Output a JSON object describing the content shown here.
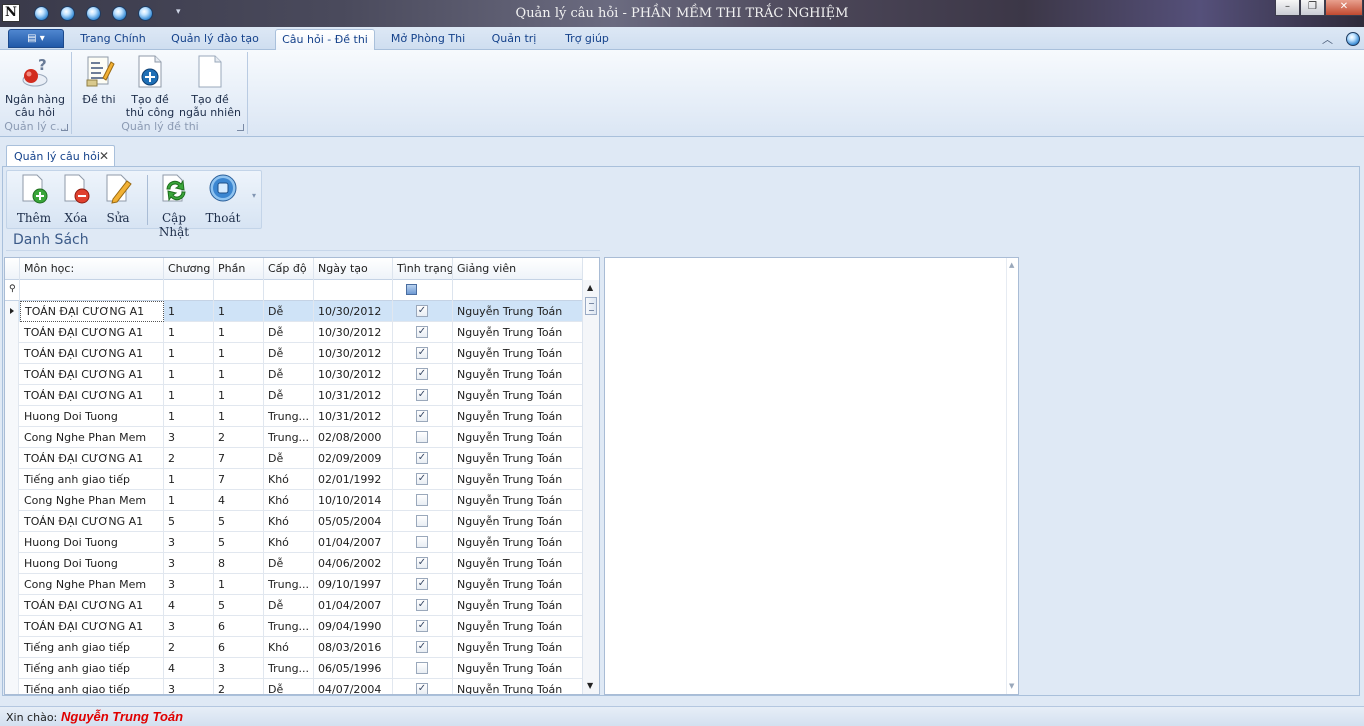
{
  "window": {
    "title": "Quản lý câu hỏi - PHẦN MỀM THI TRẮC NGHIỆM",
    "app_icon_letter": "N",
    "controls": [
      "minimize",
      "restore",
      "close"
    ]
  },
  "ribbon": {
    "tabs": [
      {
        "label": "Trang Chính",
        "active": false
      },
      {
        "label": "Quản lý đào tạo",
        "active": false
      },
      {
        "label": "Câu hỏi - Đề thi",
        "active": true
      },
      {
        "label": "Mở Phòng Thi",
        "active": false
      },
      {
        "label": "Quản trị",
        "active": false
      },
      {
        "label": "Trợ giúp",
        "active": false
      }
    ],
    "groups": [
      {
        "label": "Quản lý c...",
        "buttons": [
          {
            "label_line1": "Ngân hàng",
            "label_line2": "câu hỏi",
            "icon": "question-bank-icon"
          }
        ]
      },
      {
        "label": "Quản lý đề thi",
        "buttons": [
          {
            "label_line1": "Đề thi",
            "label_line2": "",
            "icon": "exam-icon"
          },
          {
            "label_line1": "Tạo đề",
            "label_line2": "thủ công",
            "icon": "manual-exam-icon"
          },
          {
            "label_line1": "Tạo đề",
            "label_line2": "ngẫu nhiên",
            "icon": "random-exam-icon"
          }
        ]
      }
    ]
  },
  "document_tab": {
    "label": "Quản lý câu hỏi",
    "close_glyph": "✕"
  },
  "toolbar": {
    "buttons": [
      {
        "label": "Thêm",
        "icon": "add-doc-icon"
      },
      {
        "label": "Xóa",
        "icon": "delete-doc-icon"
      },
      {
        "label": "Sửa",
        "icon": "edit-doc-icon"
      },
      {
        "label": "Cập Nhật",
        "icon": "refresh-icon"
      },
      {
        "label": "Thoát",
        "icon": "exit-icon"
      }
    ]
  },
  "section_title": "Danh Sách",
  "grid": {
    "columns": [
      "Môn học:",
      "Chương",
      "Phần",
      "Cấp độ",
      "Ngày tạo",
      "Tình trạng",
      "Giảng viên"
    ],
    "rows": [
      {
        "mon": "TOÁN ĐẠI CƯƠNG A1",
        "chuong": "1",
        "phan": "1",
        "capdo": "Dễ",
        "ngay": "10/30/2012",
        "checked": true,
        "gv": "Nguyễn Trung Toán"
      },
      {
        "mon": "TOÁN ĐẠI CƯƠNG A1",
        "chuong": "1",
        "phan": "1",
        "capdo": "Dễ",
        "ngay": "10/30/2012",
        "checked": true,
        "gv": "Nguyễn Trung Toán"
      },
      {
        "mon": "TOÁN ĐẠI CƯƠNG A1",
        "chuong": "1",
        "phan": "1",
        "capdo": "Dễ",
        "ngay": "10/30/2012",
        "checked": true,
        "gv": "Nguyễn Trung Toán"
      },
      {
        "mon": "TOÁN ĐẠI CƯƠNG A1",
        "chuong": "1",
        "phan": "1",
        "capdo": "Dễ",
        "ngay": "10/30/2012",
        "checked": true,
        "gv": "Nguyễn Trung Toán"
      },
      {
        "mon": "TOÁN ĐẠI CƯƠNG A1",
        "chuong": "1",
        "phan": "1",
        "capdo": "Dễ",
        "ngay": "10/31/2012",
        "checked": true,
        "gv": "Nguyễn Trung Toán"
      },
      {
        "mon": "Huong Doi Tuong",
        "chuong": "1",
        "phan": "1",
        "capdo": "Trung...",
        "ngay": "10/31/2012",
        "checked": true,
        "gv": "Nguyễn Trung Toán"
      },
      {
        "mon": "Cong Nghe Phan Mem",
        "chuong": "3",
        "phan": "2",
        "capdo": "Trung...",
        "ngay": "02/08/2000",
        "checked": false,
        "gv": "Nguyễn Trung Toán"
      },
      {
        "mon": "TOÁN ĐẠI CƯƠNG A1",
        "chuong": "2",
        "phan": "7",
        "capdo": "Dễ",
        "ngay": "02/09/2009",
        "checked": true,
        "gv": "Nguyễn Trung Toán"
      },
      {
        "mon": "Tiếng anh giao tiếp",
        "chuong": "1",
        "phan": "7",
        "capdo": "Khó",
        "ngay": "02/01/1992",
        "checked": true,
        "gv": "Nguyễn Trung Toán"
      },
      {
        "mon": "Cong Nghe Phan Mem",
        "chuong": "1",
        "phan": "4",
        "capdo": "Khó",
        "ngay": "10/10/2014",
        "checked": false,
        "gv": "Nguyễn Trung Toán"
      },
      {
        "mon": "TOÁN ĐẠI CƯƠNG A1",
        "chuong": "5",
        "phan": "5",
        "capdo": "Khó",
        "ngay": "05/05/2004",
        "checked": false,
        "gv": "Nguyễn Trung Toán"
      },
      {
        "mon": "Huong Doi Tuong",
        "chuong": "3",
        "phan": "5",
        "capdo": "Khó",
        "ngay": "01/04/2007",
        "checked": false,
        "gv": "Nguyễn Trung Toán"
      },
      {
        "mon": "Huong Doi Tuong",
        "chuong": "3",
        "phan": "8",
        "capdo": "Dễ",
        "ngay": "04/06/2002",
        "checked": true,
        "gv": "Nguyễn Trung Toán"
      },
      {
        "mon": "Cong Nghe Phan Mem",
        "chuong": "3",
        "phan": "1",
        "capdo": "Trung...",
        "ngay": "09/10/1997",
        "checked": true,
        "gv": "Nguyễn Trung Toán"
      },
      {
        "mon": "TOÁN ĐẠI CƯƠNG A1",
        "chuong": "4",
        "phan": "5",
        "capdo": "Dễ",
        "ngay": "01/04/2007",
        "checked": true,
        "gv": "Nguyễn Trung Toán"
      },
      {
        "mon": "TOÁN ĐẠI CƯƠNG A1",
        "chuong": "3",
        "phan": "6",
        "capdo": "Trung...",
        "ngay": "09/04/1990",
        "checked": true,
        "gv": "Nguyễn Trung Toán"
      },
      {
        "mon": "Tiếng anh giao tiếp",
        "chuong": "2",
        "phan": "6",
        "capdo": "Khó",
        "ngay": "08/03/2016",
        "checked": true,
        "gv": "Nguyễn Trung Toán"
      },
      {
        "mon": "Tiếng anh giao tiếp",
        "chuong": "4",
        "phan": "3",
        "capdo": "Trung...",
        "ngay": "06/05/1996",
        "checked": false,
        "gv": "Nguyễn Trung Toán"
      },
      {
        "mon": "Tiếng anh giao tiếp",
        "chuong": "3",
        "phan": "2",
        "capdo": "Dễ",
        "ngay": "04/07/2004",
        "checked": true,
        "gv": "Nguyễn Trung Toán"
      }
    ]
  },
  "status": {
    "label": "Xin chào:",
    "user": "Nguyễn Trung Toán"
  },
  "colors": {
    "accent": "#15428b",
    "status_user": "#e00000",
    "selected_row": "#cfe3f7"
  }
}
